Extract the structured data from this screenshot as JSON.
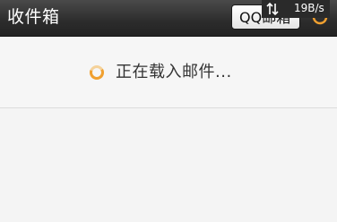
{
  "header": {
    "title": "收件箱",
    "account_button": "QQ邮箱",
    "refresh_icon": "refresh-spinner-icon"
  },
  "status_overlay": {
    "speed": "19B/s",
    "icon": "updown-arrows-icon"
  },
  "main": {
    "loading_text": "正在载入邮件...",
    "loading_icon": "loading-spinner-icon"
  },
  "colors": {
    "accent_orange": "#f0a030",
    "topbar": "#2c2c2c",
    "background": "#f4f4f4"
  }
}
